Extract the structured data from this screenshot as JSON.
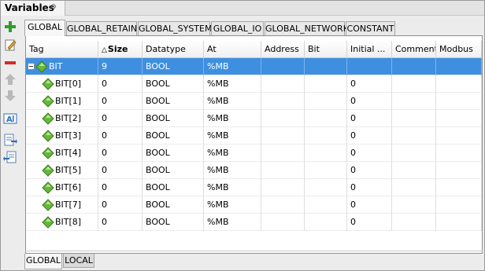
{
  "window": {
    "title": "Variables",
    "close_glyph": "⊗"
  },
  "toolbar": {
    "icons": [
      "add-icon",
      "edit-icon",
      "remove-icon",
      "move-up-icon",
      "move-down-icon",
      "rename-icon",
      "import-icon",
      "export-icon"
    ]
  },
  "tabs": [
    {
      "label": "GLOBAL",
      "active": true
    },
    {
      "label": "GLOBAL_RETAIN",
      "active": false
    },
    {
      "label": "GLOBAL_SYSTEM",
      "active": false
    },
    {
      "label": "GLOBAL_IO",
      "active": false
    },
    {
      "label": "GLOBAL_NETWORK",
      "active": false
    },
    {
      "label": "CONSTANT",
      "active": false
    }
  ],
  "table": {
    "columns": [
      "Tag",
      "Size",
      "Datatype",
      "At",
      "Address",
      "Bit",
      "Initial ...",
      "Comment",
      "Modbus"
    ],
    "sort_indicator": "△",
    "sorted_column": "Size",
    "rows": [
      {
        "tag": "BIT",
        "size": "9",
        "datatype": "BOOL",
        "at": "%MB",
        "address": "",
        "bit": "",
        "initial": "",
        "comment": "",
        "modbus": "",
        "parent": true,
        "selected": true
      },
      {
        "tag": "BIT[0]",
        "size": "0",
        "datatype": "BOOL",
        "at": "%MB",
        "address": "",
        "bit": "",
        "initial": "0",
        "comment": "",
        "modbus": ""
      },
      {
        "tag": "BIT[1]",
        "size": "0",
        "datatype": "BOOL",
        "at": "%MB",
        "address": "",
        "bit": "",
        "initial": "0",
        "comment": "",
        "modbus": ""
      },
      {
        "tag": "BIT[2]",
        "size": "0",
        "datatype": "BOOL",
        "at": "%MB",
        "address": "",
        "bit": "",
        "initial": "0",
        "comment": "",
        "modbus": ""
      },
      {
        "tag": "BIT[3]",
        "size": "0",
        "datatype": "BOOL",
        "at": "%MB",
        "address": "",
        "bit": "",
        "initial": "0",
        "comment": "",
        "modbus": ""
      },
      {
        "tag": "BIT[4]",
        "size": "0",
        "datatype": "BOOL",
        "at": "%MB",
        "address": "",
        "bit": "",
        "initial": "0",
        "comment": "",
        "modbus": ""
      },
      {
        "tag": "BIT[5]",
        "size": "0",
        "datatype": "BOOL",
        "at": "%MB",
        "address": "",
        "bit": "",
        "initial": "0",
        "comment": "",
        "modbus": ""
      },
      {
        "tag": "BIT[6]",
        "size": "0",
        "datatype": "BOOL",
        "at": "%MB",
        "address": "",
        "bit": "",
        "initial": "0",
        "comment": "",
        "modbus": ""
      },
      {
        "tag": "BIT[7]",
        "size": "0",
        "datatype": "BOOL",
        "at": "%MB",
        "address": "",
        "bit": "",
        "initial": "0",
        "comment": "",
        "modbus": ""
      },
      {
        "tag": "BIT[8]",
        "size": "0",
        "datatype": "BOOL",
        "at": "%MB",
        "address": "",
        "bit": "",
        "initial": "0",
        "comment": "",
        "modbus": ""
      }
    ]
  },
  "bottom_tabs": [
    {
      "label": "GLOBAL",
      "active": true
    },
    {
      "label": "LOCAL",
      "active": false
    }
  ],
  "colors": {
    "selection": "#3f8fe0",
    "add_green": "#2e9e2e",
    "remove_red": "#d42a2a",
    "diamond_green": "#67b83a"
  }
}
